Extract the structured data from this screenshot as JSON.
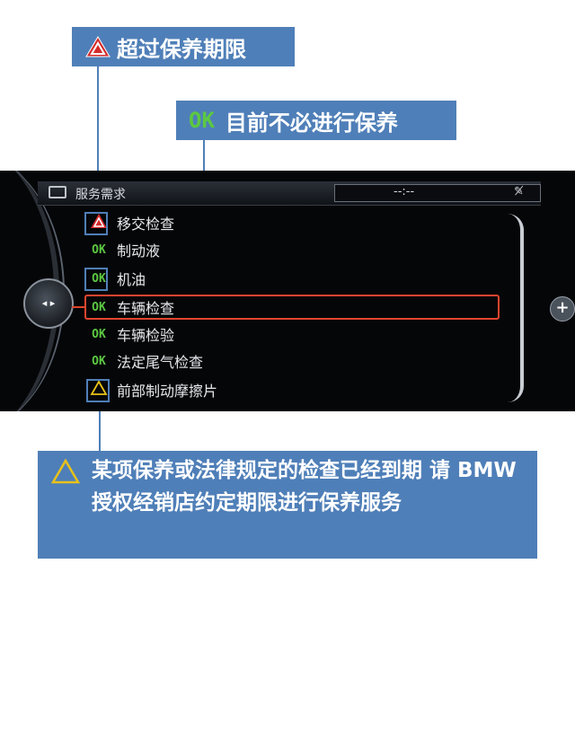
{
  "callouts": {
    "overdue": "超过保养期限",
    "ok_status": "OK",
    "ok_desc": "目前不必进行保养",
    "due_soon": "某项保养或法律规定的检查已经到期 请 BMW 授权经销店约定期限进行保养服务"
  },
  "screen": {
    "title": "服务需求",
    "time": "--:--",
    "knob": "◂ ▸",
    "plus": "+",
    "items": [
      {
        "status": "",
        "label": "移交检查"
      },
      {
        "status": "OK",
        "label": "制动液"
      },
      {
        "status": "OK",
        "label": "机油"
      },
      {
        "status": "OK",
        "label": "车辆检查"
      },
      {
        "status": "OK",
        "label": "车辆检验"
      },
      {
        "status": "OK",
        "label": "法定尾气检查"
      },
      {
        "status": "",
        "label": "前部制动摩擦片"
      }
    ]
  },
  "colors": {
    "callout_bg": "#4f7fb8",
    "ok": "#5cc842",
    "warn_red": "#d42a2a",
    "warn_yellow": "#e8c21a",
    "highlight": "#e0452e"
  }
}
